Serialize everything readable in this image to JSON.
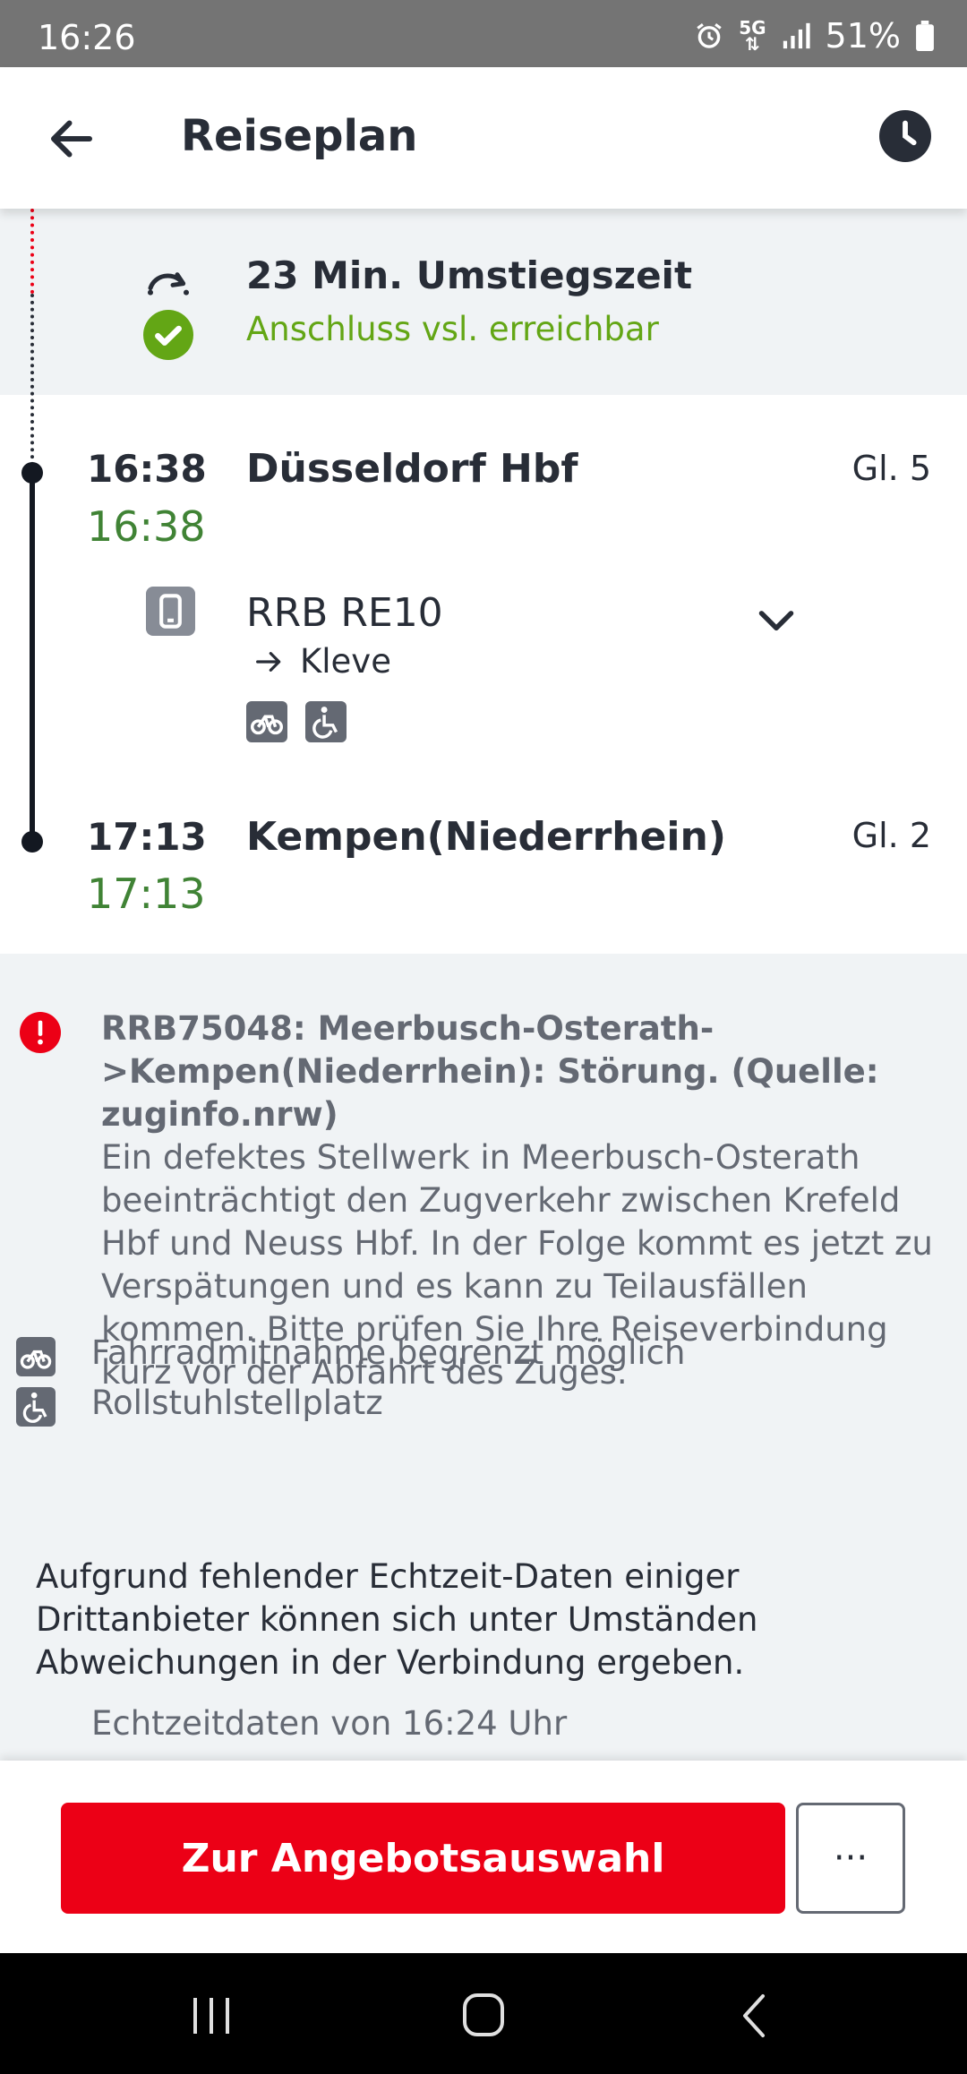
{
  "status_bar": {
    "time": "16:26",
    "network": "5G",
    "battery": "51%"
  },
  "header": {
    "title": "Reiseplan",
    "back_icon": "arrow-left-icon",
    "time_icon": "clock-icon"
  },
  "transfer": {
    "title": "23 Min. Umstiegszeit",
    "status": "Anschluss vsl. erreichbar",
    "status_color": "#63a615"
  },
  "stops": [
    {
      "scheduled": "16:38",
      "realtime": "16:38",
      "name": "Düsseldorf Hbf",
      "platform": "Gl. 5"
    },
    {
      "scheduled": "17:13",
      "realtime": "17:13",
      "name": "Kempen(Niederrhein)",
      "platform": "Gl. 2"
    }
  ],
  "train": {
    "name": "RRB RE10",
    "direction": "Kleve",
    "amenities": [
      "bicycle-icon",
      "wheelchair-icon"
    ]
  },
  "disruption": {
    "headline": "RRB75048: Meerbusch-Osterath->Kempen(Niederrhein): Störung. (Quelle: zuginfo.nrw)",
    "body": "Ein defektes Stellwerk in Meerbusch-Osterath beeinträchtigt den Zugverkehr zwischen Krefeld Hbf und Neuss Hbf. In der Folge kommt es jetzt zu Verspätungen und es kann zu Teilausfällen kommen. Bitte prüfen Sie Ihre Reiseverbindung kurz vor der Abfahrt des Zuges."
  },
  "features": [
    {
      "icon": "bicycle-icon",
      "label": "Fahrradmitnahme begrenzt möglich"
    },
    {
      "icon": "wheelchair-icon",
      "label": "Rollstuhlstellplatz"
    }
  ],
  "notice": "Aufgrund fehlender Echtzeit-Daten einiger Drittanbieter können sich unter Umständen Abweichungen in der Verbindung ergeben.",
  "realtime_note": "Echtzeitdaten von 16:24 Uhr",
  "actions": {
    "primary": "Zur Angebotsauswahl",
    "more": "···"
  },
  "colors": {
    "brand_red": "#ec0016",
    "realtime_green": "#408335",
    "text": "#282d37"
  }
}
